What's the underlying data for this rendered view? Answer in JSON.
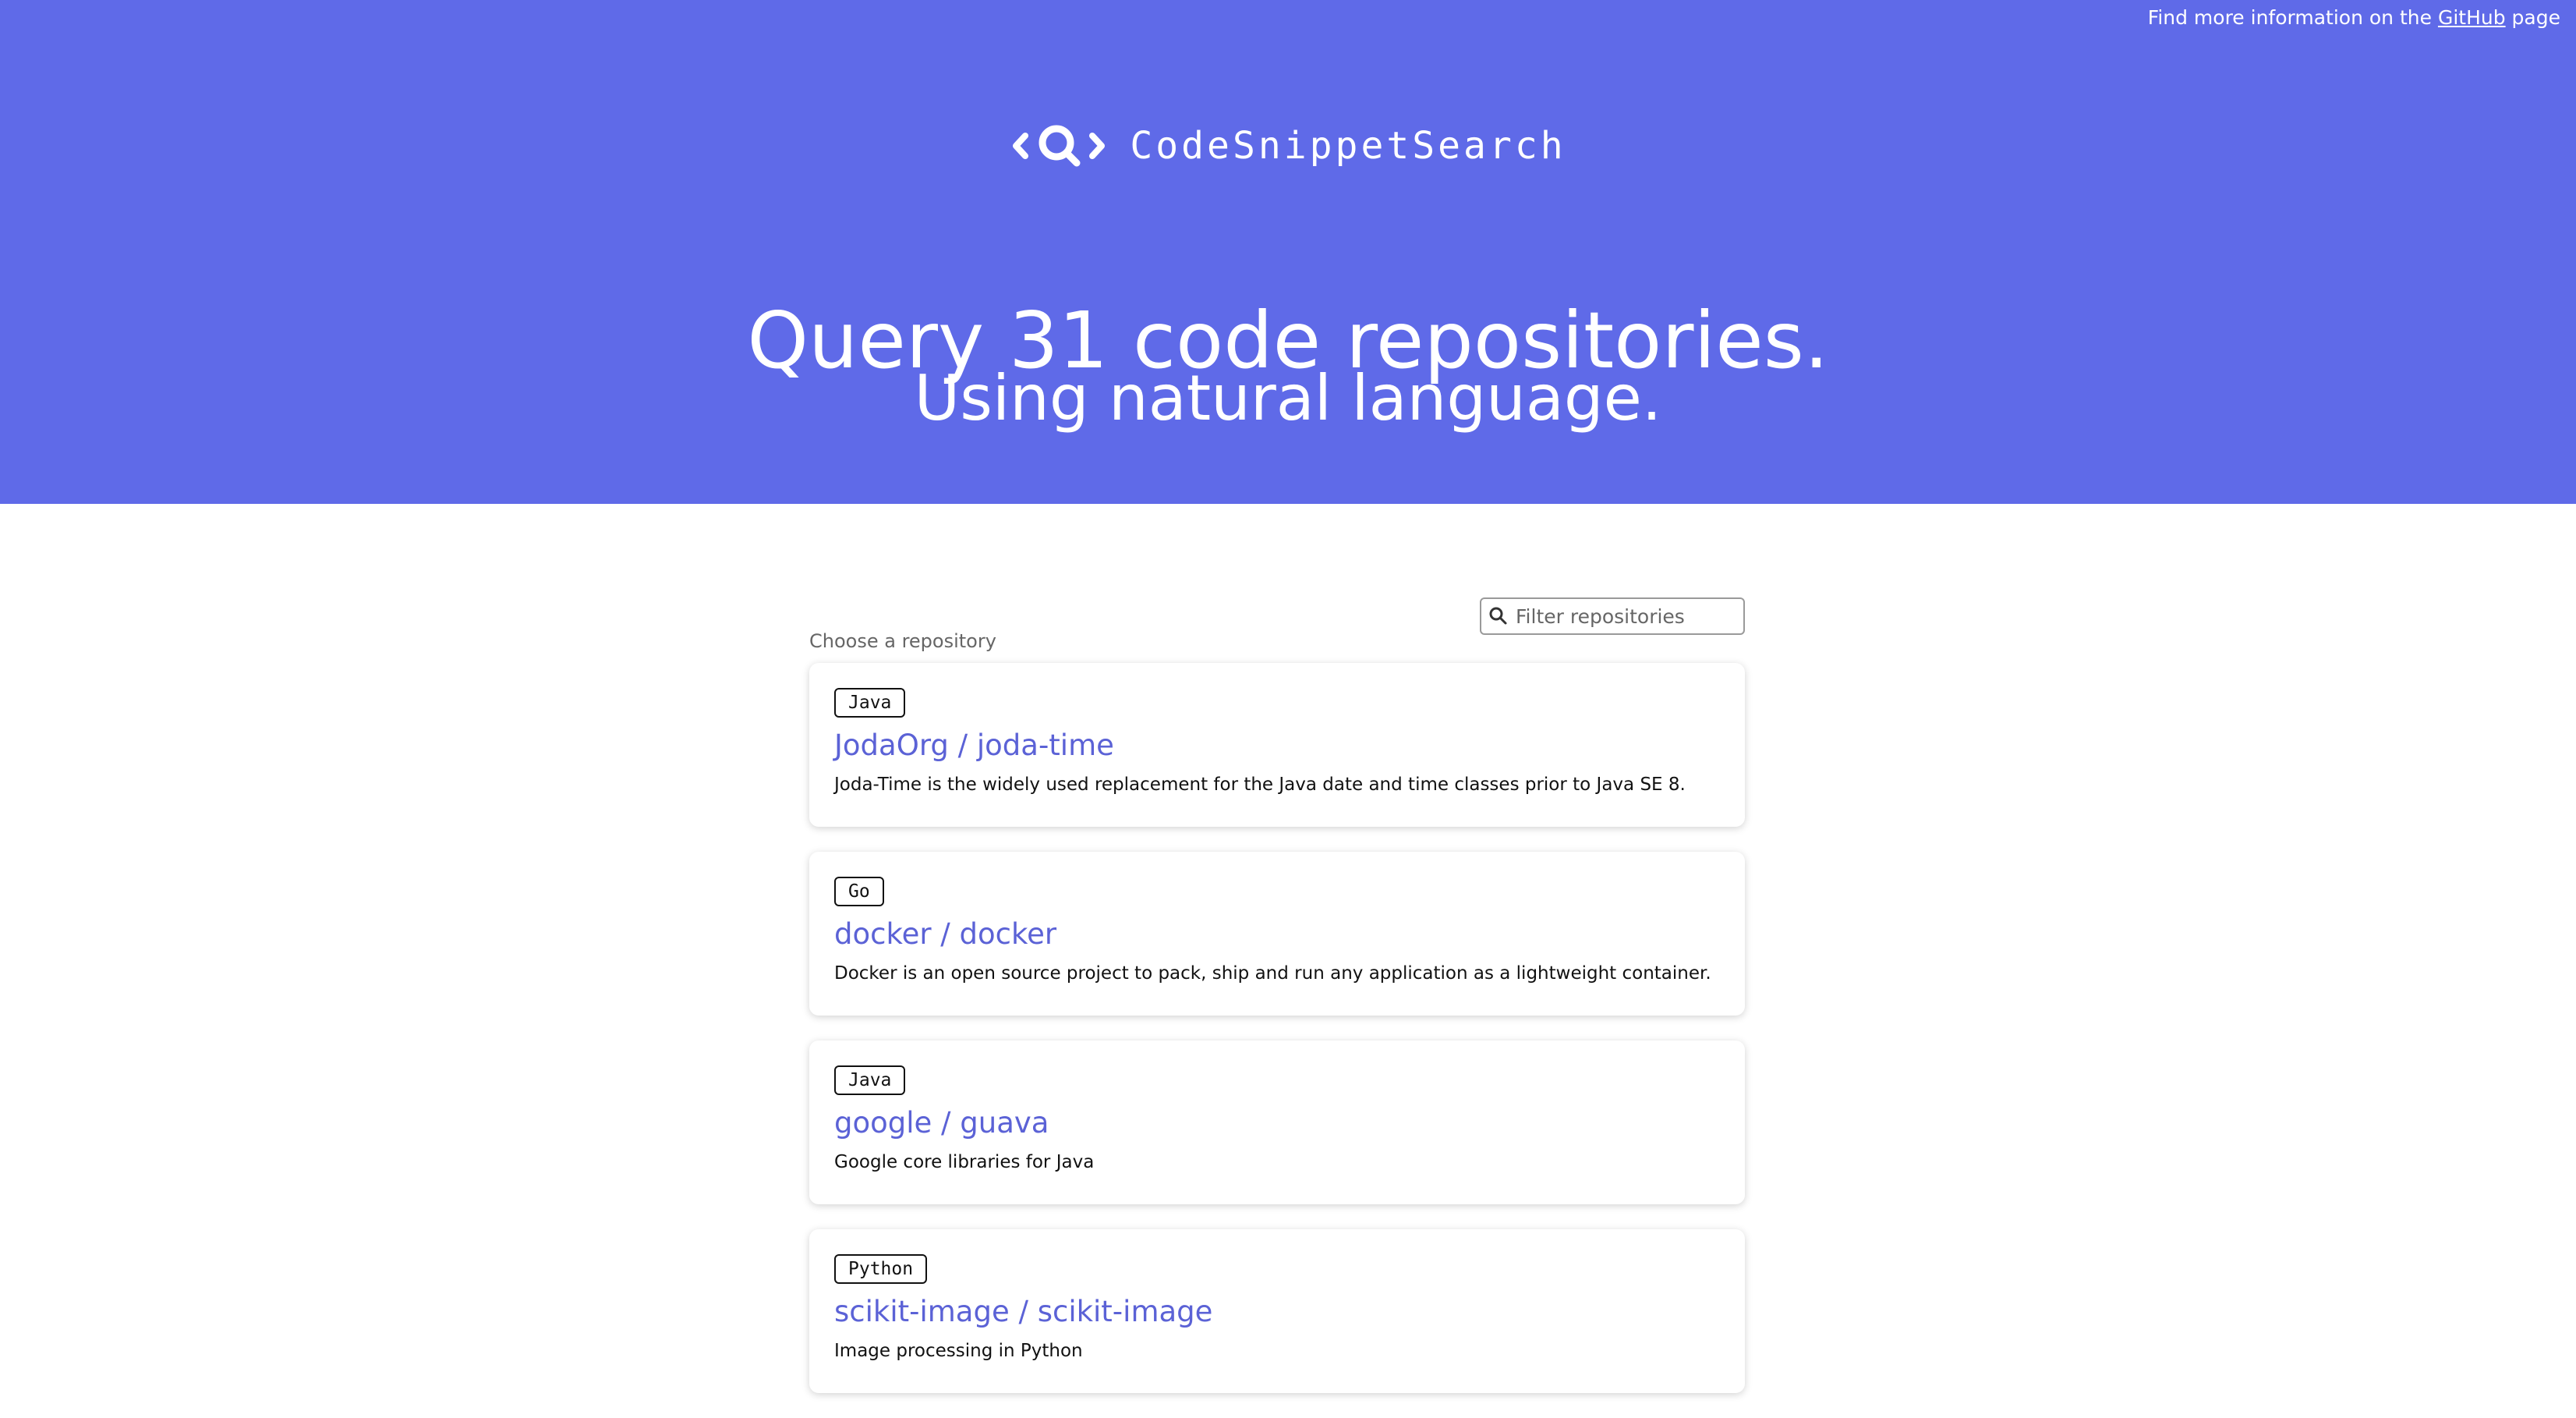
{
  "header": {
    "note_prefix": "Find more information on the",
    "note_link": "GitHub",
    "note_suffix": "page",
    "logo_text": "CodeSnippetSearch",
    "title": "Query 31 code repositories.",
    "subtitle": "Using natural language.",
    "background_color": "#5f6ae8"
  },
  "repositories_section": {
    "label": "Choose a repository",
    "filter_placeholder": "Filter repositories",
    "filter_value": ""
  },
  "repositories": [
    {
      "language": "Java",
      "name": "JodaOrg / joda-time",
      "description": "Joda-Time is the widely used replacement for the Java date and time classes prior to Java SE 8."
    },
    {
      "language": "Go",
      "name": "docker / docker",
      "description": "Docker is an open source project to pack, ship and run any application as a lightweight container."
    },
    {
      "language": "Java",
      "name": "google / guava",
      "description": "Google core libraries for Java"
    },
    {
      "language": "Python",
      "name": "scikit-image / scikit-image",
      "description": "Image processing in Python"
    }
  ],
  "icons": {
    "logo": "code-search-logo-icon",
    "filter": "search-icon"
  },
  "colors": {
    "accent": "#5f6ae8",
    "link": "#5b62d6"
  }
}
